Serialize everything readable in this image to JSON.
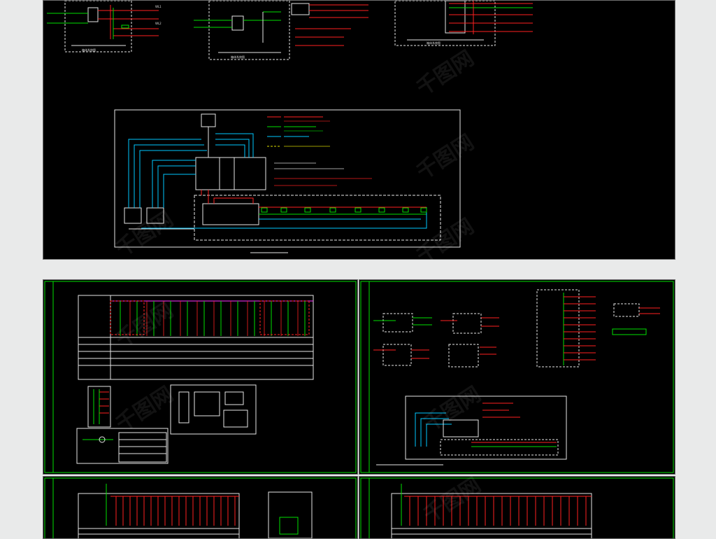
{
  "watermark": {
    "text": "千图网"
  },
  "colors": {
    "page_bg": "#e9eaea",
    "drawing_bg": "#000000",
    "line_red": "#ff2020",
    "line_green": "#00e000",
    "line_cyan": "#00c8ff",
    "line_white": "#e6e6e6",
    "line_magenta": "#ff33ff",
    "line_yellow": "#e0e000"
  },
  "sheets": [
    {
      "name": "fire-alarm-system-and-distribution-sheet",
      "region": "top"
    },
    {
      "name": "distribution-schedule-sheet",
      "region": "middle-left"
    },
    {
      "name": "distribution-box-diagrams-sheet",
      "region": "middle-right"
    },
    {
      "name": "distribution-panel-schedule-sheet-1",
      "region": "bottom-left"
    },
    {
      "name": "distribution-panel-schedule-sheet-2",
      "region": "bottom-right"
    }
  ]
}
